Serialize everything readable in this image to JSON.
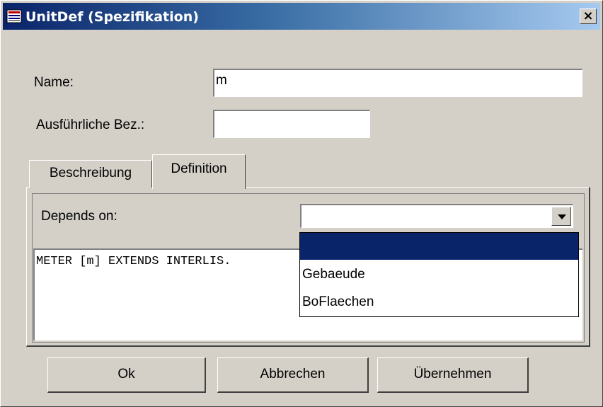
{
  "window": {
    "title": "UnitDef (Spezifikation)",
    "close_label": "×"
  },
  "form": {
    "name_label": "Name:",
    "name_value": "m",
    "full_label": "Ausführliche Bez.:",
    "full_value": ""
  },
  "tabs": [
    {
      "label": "Beschreibung",
      "active": false
    },
    {
      "label": "Definition",
      "active": true
    }
  ],
  "definition": {
    "depends_on_label": "Depends on:",
    "combo_value": "",
    "dropdown_options": [
      "",
      "Gebaeude",
      "BoFlaechen"
    ],
    "selected_index": 0,
    "text": "METER [m] EXTENDS INTERLIS."
  },
  "buttons": {
    "ok": "Ok",
    "cancel": "Abbrechen",
    "apply": "Übernehmen"
  },
  "colors": {
    "title_gradient_start": "#0a246a",
    "title_gradient_end": "#a6caf0",
    "selection": "#0a246a",
    "face": "#d4d0c8"
  },
  "icons": {
    "title": "app-icon",
    "close": "close-icon",
    "combo": "chevron-down-icon"
  }
}
